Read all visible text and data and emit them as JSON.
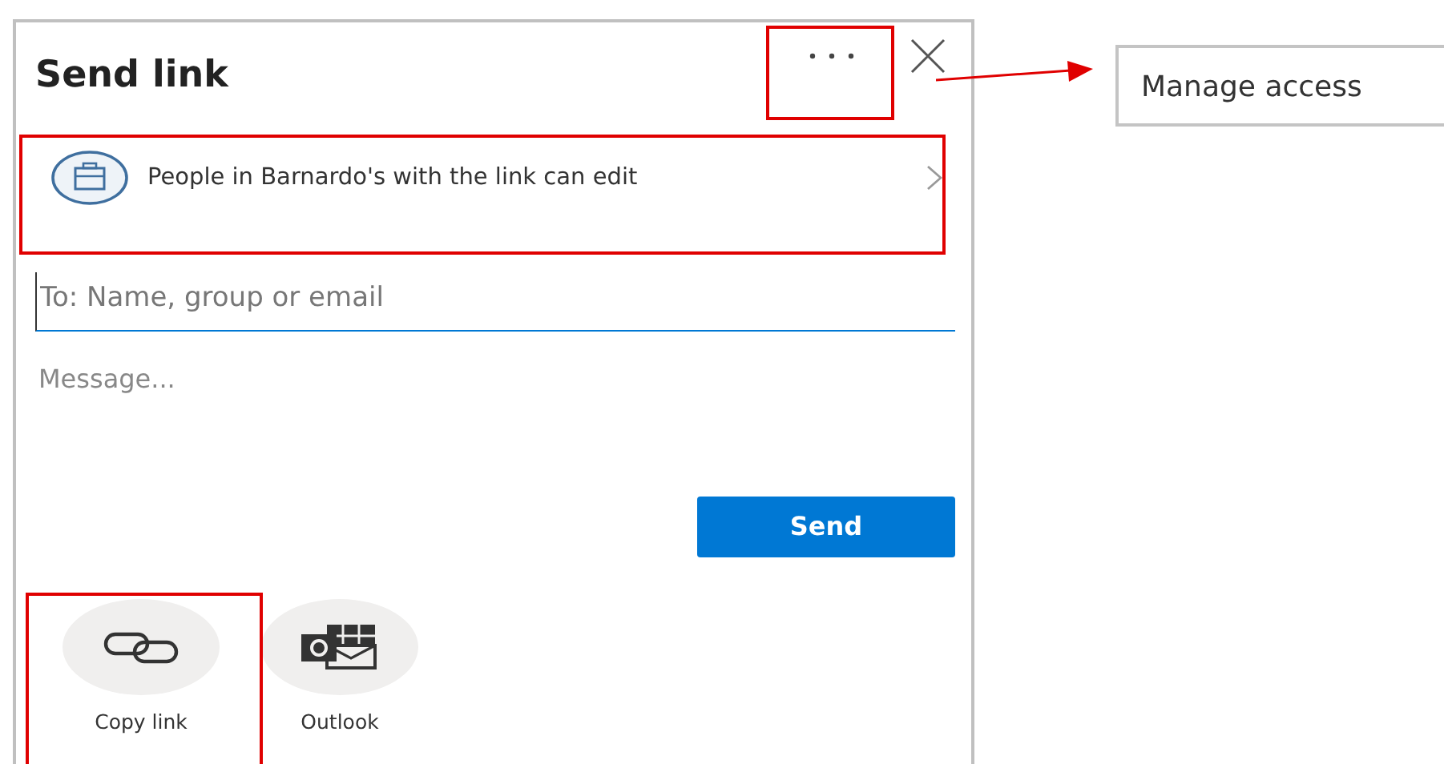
{
  "dialog": {
    "title": "Send link",
    "link_setting": "People in Barnardo's with the link can edit",
    "recipient": {
      "placeholder": "To: Name, group or email"
    },
    "message": {
      "placeholder": "Message..."
    },
    "send_button": "Send",
    "share_options": [
      {
        "label": "Copy link",
        "kind": "link"
      },
      {
        "label": "Outlook",
        "kind": "outlook"
      }
    ]
  },
  "callout": {
    "label": "Manage access"
  }
}
